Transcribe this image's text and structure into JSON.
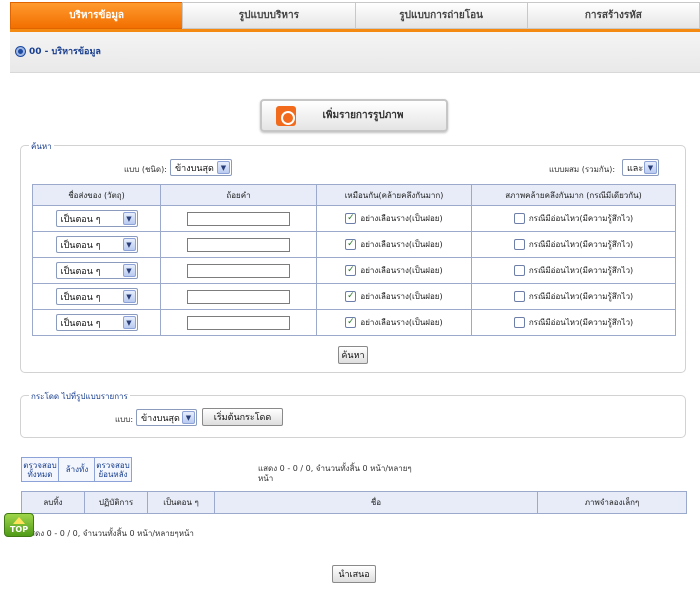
{
  "tabs": [
    {
      "label": "บริหารข้อมูล",
      "active": true
    },
    {
      "label": "รูปแบบบริหาร",
      "active": false
    },
    {
      "label": "รูปแบบการถ่ายโอน",
      "active": false
    },
    {
      "label": "การสร้างรหัส",
      "active": false
    }
  ],
  "breadcrumb": "00 - บริหารข้อมูล",
  "add_button": "เพิ่มรายการรูปภาพ",
  "search": {
    "legend": "ค้นหา",
    "type_label": "แบบ (ชนิด):",
    "type_value": "ข้างบนสุด",
    "combine_label": "แบบผสม (รวมกัน):",
    "combine_value": "และ",
    "columns": [
      "ชื่อส่งของ (วัตถุ)",
      "ถ้อยคำ",
      "เหมือนกัน(คล้ายคลึงกันมาก)",
      "สภาพคล้ายคลึงกันมาก (กรณีมีเดียวกัน)"
    ],
    "rows": [
      {
        "field": "เป็นตอน ๆ",
        "term": "",
        "similar_checked": true,
        "similar_label": "อย่างเลือนราง(เป็นฝอย)",
        "case_checked": false,
        "case_label": "กรณีมีอ่อนไหว(มีความรู้สึกไว)"
      },
      {
        "field": "เป็นตอน ๆ",
        "term": "",
        "similar_checked": true,
        "similar_label": "อย่างเลือนราง(เป็นฝอย)",
        "case_checked": false,
        "case_label": "กรณีมีอ่อนไหว(มีความรู้สึกไว)"
      },
      {
        "field": "เป็นตอน ๆ",
        "term": "",
        "similar_checked": true,
        "similar_label": "อย่างเลือนราง(เป็นฝอย)",
        "case_checked": false,
        "case_label": "กรณีมีอ่อนไหว(มีความรู้สึกไว)"
      },
      {
        "field": "เป็นตอน ๆ",
        "term": "",
        "similar_checked": true,
        "similar_label": "อย่างเลือนราง(เป็นฝอย)",
        "case_checked": false,
        "case_label": "กรณีมีอ่อนไหว(มีความรู้สึกไว)"
      },
      {
        "field": "เป็นตอน ๆ",
        "term": "",
        "similar_checked": true,
        "similar_label": "อย่างเลือนราง(เป็นฝอย)",
        "case_checked": false,
        "case_label": "กรณีมีอ่อนไหว(มีความรู้สึกไว)"
      }
    ],
    "button": "ค้นหา"
  },
  "jump": {
    "legend": "กระโดด ไปที่รูปแบบรายการ",
    "type_label": "แบบ:",
    "type_value": "ข้างบนสุด",
    "button": "เริ่มต้นกระโดด"
  },
  "mini_buttons": [
    "ตรวจสอบทั้งหมด",
    "ล้างทั้ง",
    "ตรวจสอบย้อนหลัง"
  ],
  "pager_text": "แสดง 0 - 0 / 0, จำนวนทั้งสิ้น 0 หน้า/หลายๆ หน้า",
  "results": {
    "columns": [
      "ลบทิ้ง",
      "ปฏิบัติการ",
      "เป็นตอน ๆ",
      "ชื่อ",
      "ภาพจำลองเล็กๆ"
    ]
  },
  "pager_bottom": "แสดง 0 - 0 / 0, จำนวนทั้งสิ้น 0 หน้า/หลายๆหน้า",
  "top_label": "TOP",
  "submit_button": "นำเสนอ"
}
